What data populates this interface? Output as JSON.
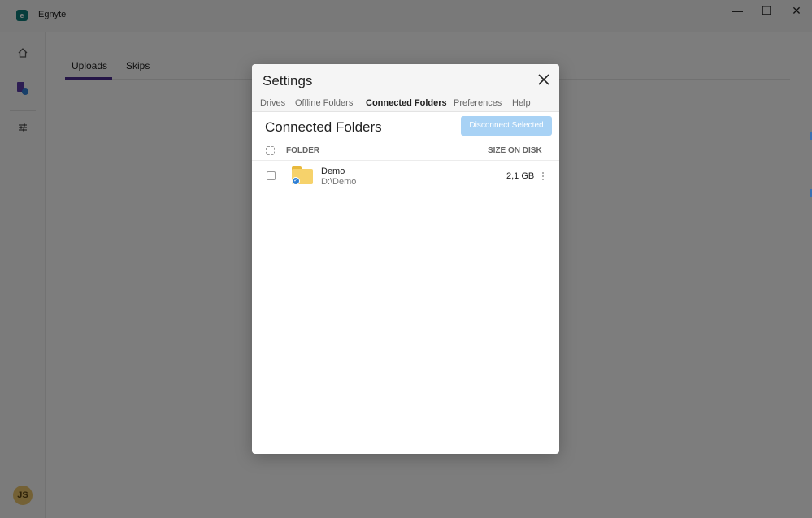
{
  "app": {
    "title": "Egnyte",
    "logo_icon": "egnyte-logo-icon",
    "window_controls": {
      "minimize": "—",
      "maximize": "☐",
      "close": "✕"
    },
    "sidebar": {
      "icons": [
        "home-icon",
        "sync-file-icon",
        "settings-sliders-icon"
      ],
      "avatar_initials": "JS"
    },
    "tabs": [
      {
        "label": "Uploads",
        "active": true
      },
      {
        "label": "Skips",
        "active": false
      }
    ]
  },
  "settings": {
    "title": "Settings",
    "close_glyph": "✕",
    "tabs": [
      {
        "label": "Drives",
        "active": false
      },
      {
        "label": "Offline Folders",
        "active": false
      },
      {
        "label": "Connected Folders",
        "active": true
      },
      {
        "label": "Preferences",
        "active": false
      },
      {
        "label": "Help",
        "active": false
      }
    ],
    "section_title": "Connected Folders",
    "disconnect_button": "Disconnect Selected",
    "columns": {
      "folder": "FOLDER",
      "size": "SIZE ON DISK"
    },
    "rows": [
      {
        "name": "Demo",
        "path": "D:\\Demo",
        "size": "2,1 GB",
        "more": "⋮"
      }
    ],
    "colors": {
      "accent": "#4b2c8f",
      "button_disabled": "#a8d2f5"
    }
  }
}
